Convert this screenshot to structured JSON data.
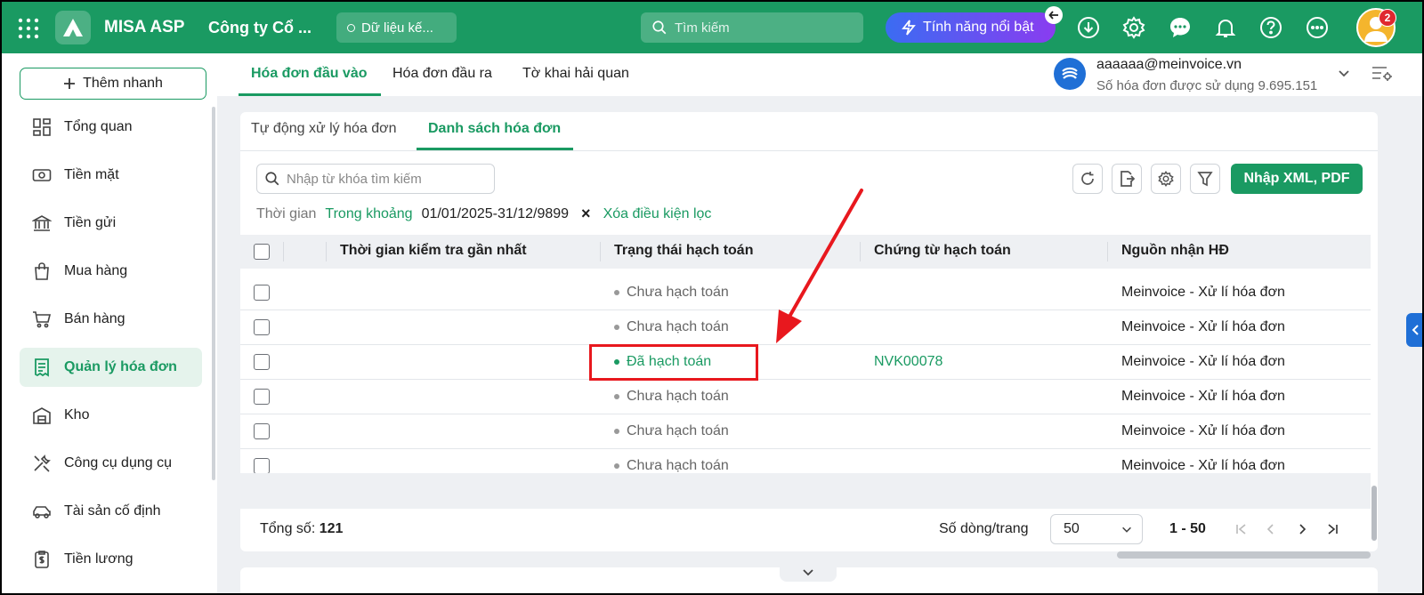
{
  "topbar": {
    "app_name": "MISA ASP",
    "company": "Công ty Cổ ...",
    "data_label": "Dữ liệu kế...",
    "search_placeholder": "Tìm kiếm",
    "feature_label": "Tính năng nổi bật",
    "notification_count": "2",
    "brand_color": "#1a9a62"
  },
  "sidebar": {
    "quick_add": "Thêm nhanh",
    "items": [
      {
        "label": "Tổng quan",
        "icon": "dashboard-icon"
      },
      {
        "label": "Tiền mặt",
        "icon": "cash-icon"
      },
      {
        "label": "Tiền gửi",
        "icon": "bank-icon"
      },
      {
        "label": "Mua hàng",
        "icon": "shopping-bag-icon"
      },
      {
        "label": "Bán hàng",
        "icon": "cart-icon"
      },
      {
        "label": "Quản lý hóa đơn",
        "icon": "invoice-icon",
        "active": true
      },
      {
        "label": "Kho",
        "icon": "warehouse-icon"
      },
      {
        "label": "Công cụ dụng cụ",
        "icon": "tools-icon"
      },
      {
        "label": "Tài sản cố định",
        "icon": "car-icon"
      },
      {
        "label": "Tiền lương",
        "icon": "salary-icon"
      }
    ]
  },
  "header": {
    "tabs": [
      "Hóa đơn đầu vào",
      "Hóa đơn đầu ra",
      "Tờ khai hải quan"
    ],
    "account_email": "aaaaaa@meinvoice.vn",
    "account_usage": "Số hóa đơn được sử dụng 9.695.151"
  },
  "main": {
    "subtabs": [
      "Tự động xử lý hóa đơn",
      "Danh sách hóa đơn"
    ],
    "keyword_placeholder": "Nhập từ khóa tìm kiếm",
    "import_button": "Nhập XML, PDF",
    "filter": {
      "label": "Thời gian",
      "mode": "Trong khoảng",
      "range": "01/01/2025-31/12/9899",
      "clear": "Xóa điều kiện lọc"
    },
    "columns": [
      "Thời gian kiểm tra gần nhất",
      "Trạng thái hạch toán",
      "Chứng từ hạch toán",
      "Nguồn nhận HĐ"
    ],
    "rows": [
      {
        "status": "Chưa hạch toán",
        "doc": "",
        "source": "Meinvoice - Xử lí hóa đơn"
      },
      {
        "status": "Chưa hạch toán",
        "doc": "",
        "source": "Meinvoice - Xử lí hóa đơn"
      },
      {
        "status": "Đã hạch toán",
        "doc": "NVK00078",
        "source": "Meinvoice - Xử lí hóa đơn",
        "done": true
      },
      {
        "status": "Chưa hạch toán",
        "doc": "",
        "source": "Meinvoice - Xử lí hóa đơn"
      },
      {
        "status": "Chưa hạch toán",
        "doc": "",
        "source": "Meinvoice - Xử lí hóa đơn"
      },
      {
        "status": "Chưa hạch toán",
        "doc": "",
        "source": "Meinvoice - Xử lí hóa đơn"
      }
    ],
    "footer": {
      "total_label": "Tổng số:",
      "total_value": "121",
      "per_page_label": "Số dòng/trang",
      "per_page_value": "50",
      "range": "1 - 50"
    }
  },
  "annotation": {
    "color": "#e8181e"
  }
}
